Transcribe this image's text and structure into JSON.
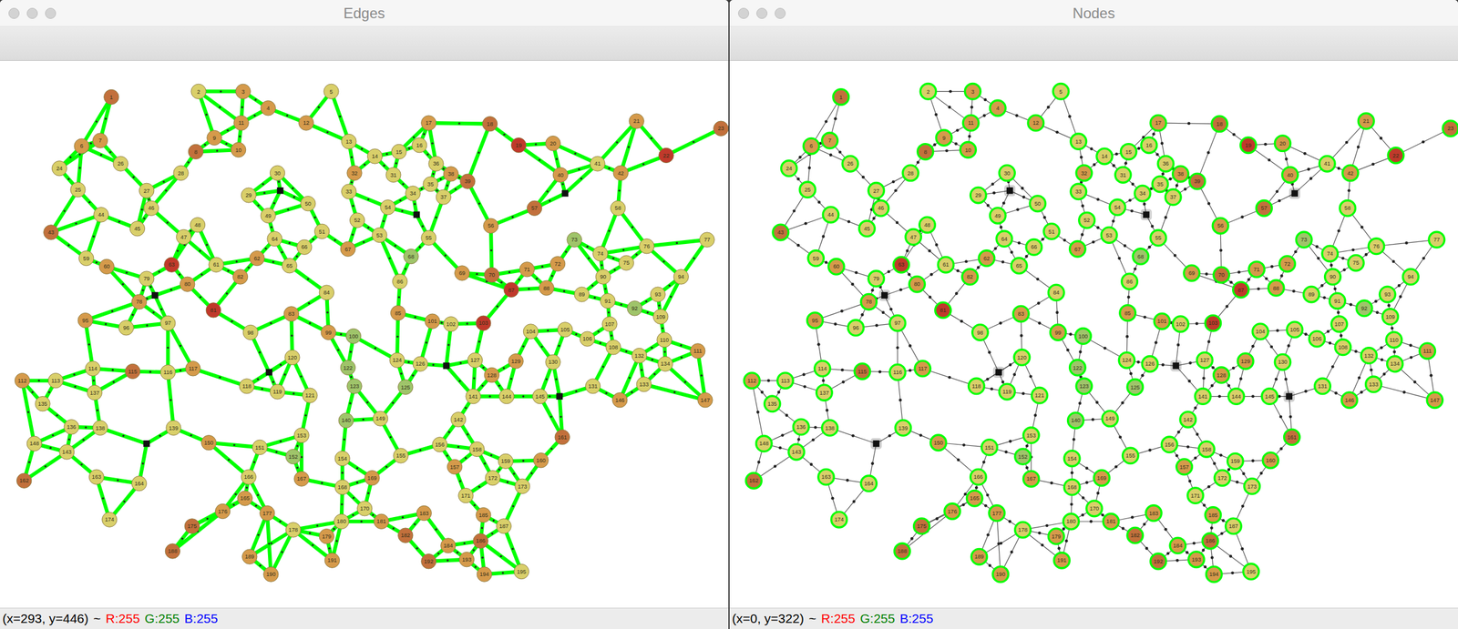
{
  "windows": [
    {
      "title": "Edges",
      "kind": "edges",
      "status": {
        "position": "(x=293, y=446)",
        "separator": "~",
        "red": "R:255",
        "green": "G:255",
        "blue": "B:255"
      }
    },
    {
      "title": "Nodes",
      "kind": "nodes",
      "status": {
        "position": "(x=0, y=322)",
        "separator": "~",
        "red": "R:255",
        "green": "G:255",
        "blue": "B:255"
      }
    }
  ],
  "nodes": [
    {
      "label": "1",
      "color": "#c2703c"
    },
    {
      "label": "2",
      "color": "#d9cf6a"
    },
    {
      "label": "3",
      "color": "#d59a4b"
    },
    {
      "label": "4",
      "color": "#d59a4b"
    },
    {
      "label": "5",
      "color": "#d9cf6a"
    },
    {
      "label": "6",
      "color": "#d59a4b"
    },
    {
      "label": "7",
      "color": "#d59a4b"
    },
    {
      "label": "8",
      "color": "#c2703c"
    },
    {
      "label": "9",
      "color": "#d59a4b"
    },
    {
      "label": "10",
      "color": "#d59a4b"
    },
    {
      "label": "11",
      "color": "#d59a4b"
    },
    {
      "label": "12",
      "color": "#d59a4b"
    },
    {
      "label": "13",
      "color": "#d9cf6a"
    },
    {
      "label": "14",
      "color": "#d9cf6a"
    },
    {
      "label": "15",
      "color": "#d9cf6a"
    },
    {
      "label": "16",
      "color": "#d9cf6a"
    },
    {
      "label": "17",
      "color": "#d59a4b"
    },
    {
      "label": "18",
      "color": "#c2703c"
    },
    {
      "label": "19",
      "color": "#c0392b"
    },
    {
      "label": "20",
      "color": "#d59a4b"
    },
    {
      "label": "21",
      "color": "#d59a4b"
    },
    {
      "label": "22",
      "color": "#c0392b"
    },
    {
      "label": "23",
      "color": "#c2703c"
    },
    {
      "label": "24",
      "color": "#d9cf6a"
    },
    {
      "label": "25",
      "color": "#d9cf6a"
    },
    {
      "label": "26",
      "color": "#d9cf6a"
    },
    {
      "label": "27",
      "color": "#d9cf6a"
    },
    {
      "label": "28",
      "color": "#d9cf6a"
    },
    {
      "label": "29",
      "color": "#d9cf6a"
    },
    {
      "label": "30",
      "color": "#d9cf6a"
    },
    {
      "label": "31",
      "color": "#d9cf6a"
    },
    {
      "label": "32",
      "color": "#d59a4b"
    },
    {
      "label": "33",
      "color": "#d9cf6a"
    },
    {
      "label": "34",
      "color": "#d9cf6a"
    },
    {
      "label": "35",
      "color": "#d9cf6a"
    },
    {
      "label": "36",
      "color": "#d9cf6a"
    },
    {
      "label": "37",
      "color": "#d9cf6a"
    },
    {
      "label": "38",
      "color": "#d59a4b"
    },
    {
      "label": "39",
      "color": "#c2703c"
    },
    {
      "label": "40",
      "color": "#d59a4b"
    },
    {
      "label": "41",
      "color": "#d9cf6a"
    },
    {
      "label": "42",
      "color": "#d59a4b"
    },
    {
      "label": "43",
      "color": "#c2703c"
    },
    {
      "label": "44",
      "color": "#d9cf6a"
    },
    {
      "label": "45",
      "color": "#d9cf6a"
    },
    {
      "label": "46",
      "color": "#d9cf6a"
    },
    {
      "label": "47",
      "color": "#d9cf6a"
    },
    {
      "label": "48",
      "color": "#d9cf6a"
    },
    {
      "label": "49",
      "color": "#d9cf6a"
    },
    {
      "label": "50",
      "color": "#d9cf6a"
    },
    {
      "label": "51",
      "color": "#d9cf6a"
    },
    {
      "label": "52",
      "color": "#d9cf6a"
    },
    {
      "label": "53",
      "color": "#d9cf6a"
    },
    {
      "label": "54",
      "color": "#d9cf6a"
    },
    {
      "label": "55",
      "color": "#d9cf6a"
    },
    {
      "label": "56",
      "color": "#d59a4b"
    },
    {
      "label": "57",
      "color": "#c2703c"
    },
    {
      "label": "58",
      "color": "#d9cf6a"
    },
    {
      "label": "59",
      "color": "#d9cf6a"
    },
    {
      "label": "60",
      "color": "#d59a4b"
    },
    {
      "label": "61",
      "color": "#d9cf6a"
    },
    {
      "label": "62",
      "color": "#d59a4b"
    },
    {
      "label": "63",
      "color": "#c0392b"
    },
    {
      "label": "64",
      "color": "#d9cf6a"
    },
    {
      "label": "65",
      "color": "#d9cf6a"
    },
    {
      "label": "66",
      "color": "#d9cf6a"
    },
    {
      "label": "67",
      "color": "#d59a4b"
    },
    {
      "label": "68",
      "color": "#9fc46a"
    },
    {
      "label": "69",
      "color": "#d59a4b"
    },
    {
      "label": "70",
      "color": "#c2703c"
    },
    {
      "label": "71",
      "color": "#d59a4b"
    },
    {
      "label": "72",
      "color": "#d59a4b"
    },
    {
      "label": "73",
      "color": "#9fc46a"
    },
    {
      "label": "74",
      "color": "#d9cf6a"
    },
    {
      "label": "75",
      "color": "#d9cf6a"
    },
    {
      "label": "76",
      "color": "#d9cf6a"
    },
    {
      "label": "77",
      "color": "#d9cf6a"
    },
    {
      "label": "78",
      "color": "#d59a4b"
    },
    {
      "label": "79",
      "color": "#d9cf6a"
    },
    {
      "label": "80",
      "color": "#d59a4b"
    },
    {
      "label": "81",
      "color": "#c0392b"
    },
    {
      "label": "82",
      "color": "#d59a4b"
    },
    {
      "label": "83",
      "color": "#d59a4b"
    },
    {
      "label": "84",
      "color": "#d9cf6a"
    },
    {
      "label": "85",
      "color": "#d59a4b"
    },
    {
      "label": "86",
      "color": "#d9cf6a"
    },
    {
      "label": "87",
      "color": "#c0392b"
    },
    {
      "label": "88",
      "color": "#d59a4b"
    },
    {
      "label": "89",
      "color": "#d9cf6a"
    },
    {
      "label": "90",
      "color": "#d9cf6a"
    },
    {
      "label": "91",
      "color": "#d9cf6a"
    },
    {
      "label": "92",
      "color": "#9fc46a"
    },
    {
      "label": "93",
      "color": "#d9cf6a"
    },
    {
      "label": "94",
      "color": "#d9cf6a"
    },
    {
      "label": "95",
      "color": "#d59a4b"
    },
    {
      "label": "96",
      "color": "#d9cf6a"
    },
    {
      "label": "97",
      "color": "#d9cf6a"
    },
    {
      "label": "98",
      "color": "#d9cf6a"
    },
    {
      "label": "99",
      "color": "#d59a4b"
    },
    {
      "label": "100",
      "color": "#9fc46a"
    },
    {
      "label": "101",
      "color": "#d59a4b"
    },
    {
      "label": "102",
      "color": "#d9cf6a"
    },
    {
      "label": "103",
      "color": "#c0392b"
    },
    {
      "label": "104",
      "color": "#d9cf6a"
    },
    {
      "label": "105",
      "color": "#d9cf6a"
    },
    {
      "label": "106",
      "color": "#d9cf6a"
    },
    {
      "label": "107",
      "color": "#d9cf6a"
    },
    {
      "label": "108",
      "color": "#d9cf6a"
    },
    {
      "label": "109",
      "color": "#d9cf6a"
    },
    {
      "label": "110",
      "color": "#d9cf6a"
    },
    {
      "label": "111",
      "color": "#d59a4b"
    },
    {
      "label": "112",
      "color": "#d59a4b"
    },
    {
      "label": "113",
      "color": "#d9cf6a"
    },
    {
      "label": "114",
      "color": "#d9cf6a"
    },
    {
      "label": "115",
      "color": "#c2703c"
    },
    {
      "label": "116",
      "color": "#d9cf6a"
    },
    {
      "label": "117",
      "color": "#d59a4b"
    },
    {
      "label": "118",
      "color": "#d9cf6a"
    },
    {
      "label": "119",
      "color": "#d9cf6a"
    },
    {
      "label": "120",
      "color": "#d9cf6a"
    },
    {
      "label": "121",
      "color": "#d9cf6a"
    },
    {
      "label": "122",
      "color": "#9fc46a"
    },
    {
      "label": "123",
      "color": "#9fc46a"
    },
    {
      "label": "124",
      "color": "#d9cf6a"
    },
    {
      "label": "125",
      "color": "#9fc46a"
    },
    {
      "label": "126",
      "color": "#d9cf6a"
    },
    {
      "label": "127",
      "color": "#d9cf6a"
    },
    {
      "label": "128",
      "color": "#d59a4b"
    },
    {
      "label": "129",
      "color": "#d59a4b"
    },
    {
      "label": "130",
      "color": "#d9cf6a"
    },
    {
      "label": "131",
      "color": "#d9cf6a"
    },
    {
      "label": "132",
      "color": "#d9cf6a"
    },
    {
      "label": "133",
      "color": "#d9cf6a"
    },
    {
      "label": "134",
      "color": "#d9cf6a"
    },
    {
      "label": "135",
      "color": "#d9cf6a"
    },
    {
      "label": "136",
      "color": "#d9cf6a"
    },
    {
      "label": "137",
      "color": "#d9cf6a"
    },
    {
      "label": "138",
      "color": "#d9cf6a"
    },
    {
      "label": "139",
      "color": "#d9cf6a"
    },
    {
      "label": "140",
      "color": "#9fc46a"
    },
    {
      "label": "141",
      "color": "#d9cf6a"
    },
    {
      "label": "142",
      "color": "#d9cf6a"
    },
    {
      "label": "143",
      "color": "#d9cf6a"
    },
    {
      "label": "144",
      "color": "#d9cf6a"
    },
    {
      "label": "145",
      "color": "#d9cf6a"
    },
    {
      "label": "146",
      "color": "#d59a4b"
    },
    {
      "label": "147",
      "color": "#d59a4b"
    },
    {
      "label": "148",
      "color": "#d9cf6a"
    },
    {
      "label": "149",
      "color": "#d9cf6a"
    },
    {
      "label": "150",
      "color": "#d59a4b"
    },
    {
      "label": "151",
      "color": "#d9cf6a"
    },
    {
      "label": "152",
      "color": "#9fc46a"
    },
    {
      "label": "153",
      "color": "#d9cf6a"
    },
    {
      "label": "154",
      "color": "#d9cf6a"
    },
    {
      "label": "155",
      "color": "#d9cf6a"
    },
    {
      "label": "156",
      "color": "#d9cf6a"
    },
    {
      "label": "157",
      "color": "#d59a4b"
    },
    {
      "label": "158",
      "color": "#d9cf6a"
    },
    {
      "label": "159",
      "color": "#d9cf6a"
    },
    {
      "label": "160",
      "color": "#d59a4b"
    },
    {
      "label": "161",
      "color": "#c2703c"
    },
    {
      "label": "162",
      "color": "#c2703c"
    },
    {
      "label": "163",
      "color": "#d9cf6a"
    },
    {
      "label": "164",
      "color": "#d9cf6a"
    },
    {
      "label": "165",
      "color": "#d59a4b"
    },
    {
      "label": "166",
      "color": "#d9cf6a"
    },
    {
      "label": "167",
      "color": "#d59a4b"
    },
    {
      "label": "168",
      "color": "#d9cf6a"
    },
    {
      "label": "169",
      "color": "#d59a4b"
    },
    {
      "label": "170",
      "color": "#d9cf6a"
    },
    {
      "label": "171",
      "color": "#d9cf6a"
    },
    {
      "label": "172",
      "color": "#d9cf6a"
    },
    {
      "label": "173",
      "color": "#d9cf6a"
    },
    {
      "label": "174",
      "color": "#d9cf6a"
    },
    {
      "label": "175",
      "color": "#c2703c"
    },
    {
      "label": "176",
      "color": "#d59a4b"
    },
    {
      "label": "177",
      "color": "#d59a4b"
    },
    {
      "label": "178",
      "color": "#d9cf6a"
    },
    {
      "label": "179",
      "color": "#d59a4b"
    },
    {
      "label": "180",
      "color": "#d9cf6a"
    },
    {
      "label": "181",
      "color": "#d59a4b"
    },
    {
      "label": "182",
      "color": "#c2703c"
    },
    {
      "label": "183",
      "color": "#d59a4b"
    },
    {
      "label": "184",
      "color": "#d59a4b"
    },
    {
      "label": "185",
      "color": "#d59a4b"
    },
    {
      "label": "186",
      "color": "#c2703c"
    },
    {
      "label": "187",
      "color": "#d9cf6a"
    },
    {
      "label": "188",
      "color": "#c2703c"
    },
    {
      "label": "189",
      "color": "#d59a4b"
    },
    {
      "label": "190",
      "color": "#d59a4b"
    },
    {
      "label": "191",
      "color": "#d59a4b"
    },
    {
      "label": "192",
      "color": "#c2703c"
    },
    {
      "label": "193",
      "color": "#d59a4b"
    },
    {
      "label": "194",
      "color": "#d59a4b"
    },
    {
      "label": "195",
      "color": "#d9cf6a"
    }
  ]
}
